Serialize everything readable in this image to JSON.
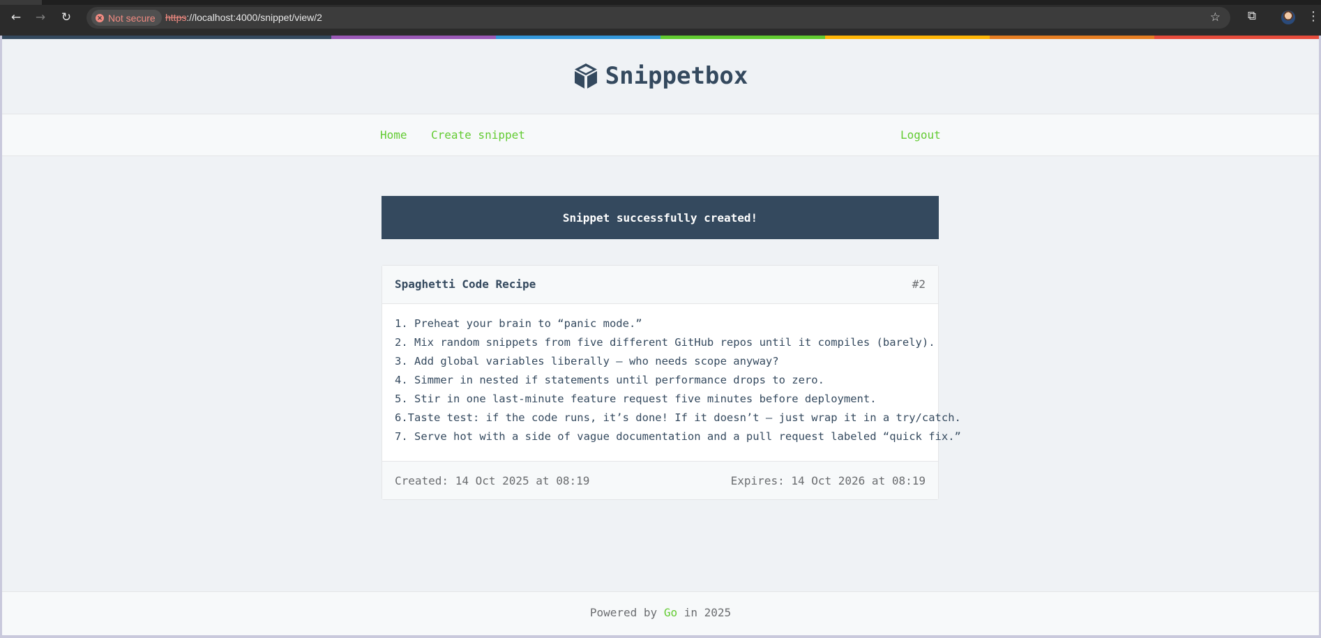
{
  "browser": {
    "security_label": "Not secure",
    "url_scheme": "https",
    "url_rest": "://localhost:4000/snippet/view/2",
    "icons": [
      "back-icon",
      "forward-icon",
      "reload-icon",
      "star-icon",
      "extensions-icon",
      "profile-avatar",
      "menu-icon"
    ]
  },
  "site": {
    "brand": "Snippetbox",
    "rainbow_colors": [
      "#34495e",
      "#34495e",
      "#9b59b6",
      "#3498db",
      "#62cb31",
      "#ffb606",
      "#e67e22",
      "#e74c3c"
    ],
    "nav": {
      "home": "Home",
      "create": "Create snippet",
      "logout": "Logout"
    },
    "flash": "Snippet successfully created!",
    "snippet": {
      "title": "Spaghetti Code Recipe",
      "id": "#2",
      "content": "1. Preheat your brain to “panic mode.”\n2. Mix random snippets from five different GitHub repos until it compiles (barely).\n3. Add global variables liberally — who needs scope anyway?\n4. Simmer in nested if statements until performance drops to zero.\n5. Stir in one last-minute feature request five minutes before deployment.\n6.Taste test: if the code runs, it’s done! If it doesn’t — just wrap it in a try/catch.\n7. Serve hot with a side of vague documentation and a pull request labeled “quick fix.”",
      "created": "Created: 14 Oct 2025 at 08:19",
      "expires": "Expires: 14 Oct 2026 at 08:19"
    },
    "footer": {
      "prefix": "Powered by ",
      "link": "Go",
      "suffix": " in 2025"
    },
    "colors": {
      "accent_green": "#62cb31",
      "dark_blue": "#34495e"
    }
  }
}
